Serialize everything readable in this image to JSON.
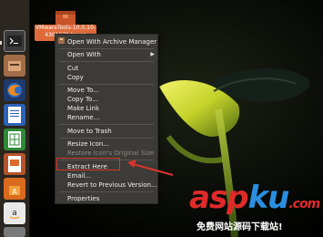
{
  "desktop": {
    "file_icon_label": "VMwareTools-10.0.10-4301679.tar.gz"
  },
  "launcher": {
    "items": [
      {
        "name": "terminal-icon"
      },
      {
        "name": "files-icon"
      },
      {
        "name": "firefox-icon"
      },
      {
        "name": "writer-icon"
      },
      {
        "name": "calc-icon"
      },
      {
        "name": "impress-icon"
      },
      {
        "name": "software-center-icon"
      },
      {
        "name": "amazon-icon"
      },
      {
        "name": "settings-icon"
      }
    ]
  },
  "context_menu": {
    "open_with_archive_manager": "Open With Archive Manager",
    "open_with": "Open With",
    "cut": "Cut",
    "copy": "Copy",
    "move_to": "Move To...",
    "copy_to": "Copy To...",
    "make_link": "Make Link",
    "rename": "Rename...",
    "move_to_trash": "Move to Trash",
    "resize_icon": "Resize Icon...",
    "restore_icon_size": "Restore Icon's Original Size",
    "extract_here": "Extract Here",
    "email": "Email...",
    "revert": "Revert to Previous Version...",
    "properties": "Properties"
  },
  "watermark": {
    "brand_asp": "asp",
    "brand_ku": "ku",
    "brand_com": ".com",
    "tagline": "免费网站源码下载站!"
  },
  "colors": {
    "launcher_bg": "#2b2620",
    "menu_bg": "#3c3b37",
    "highlight": "#d9342b",
    "label_orange": "#e06b3a"
  }
}
